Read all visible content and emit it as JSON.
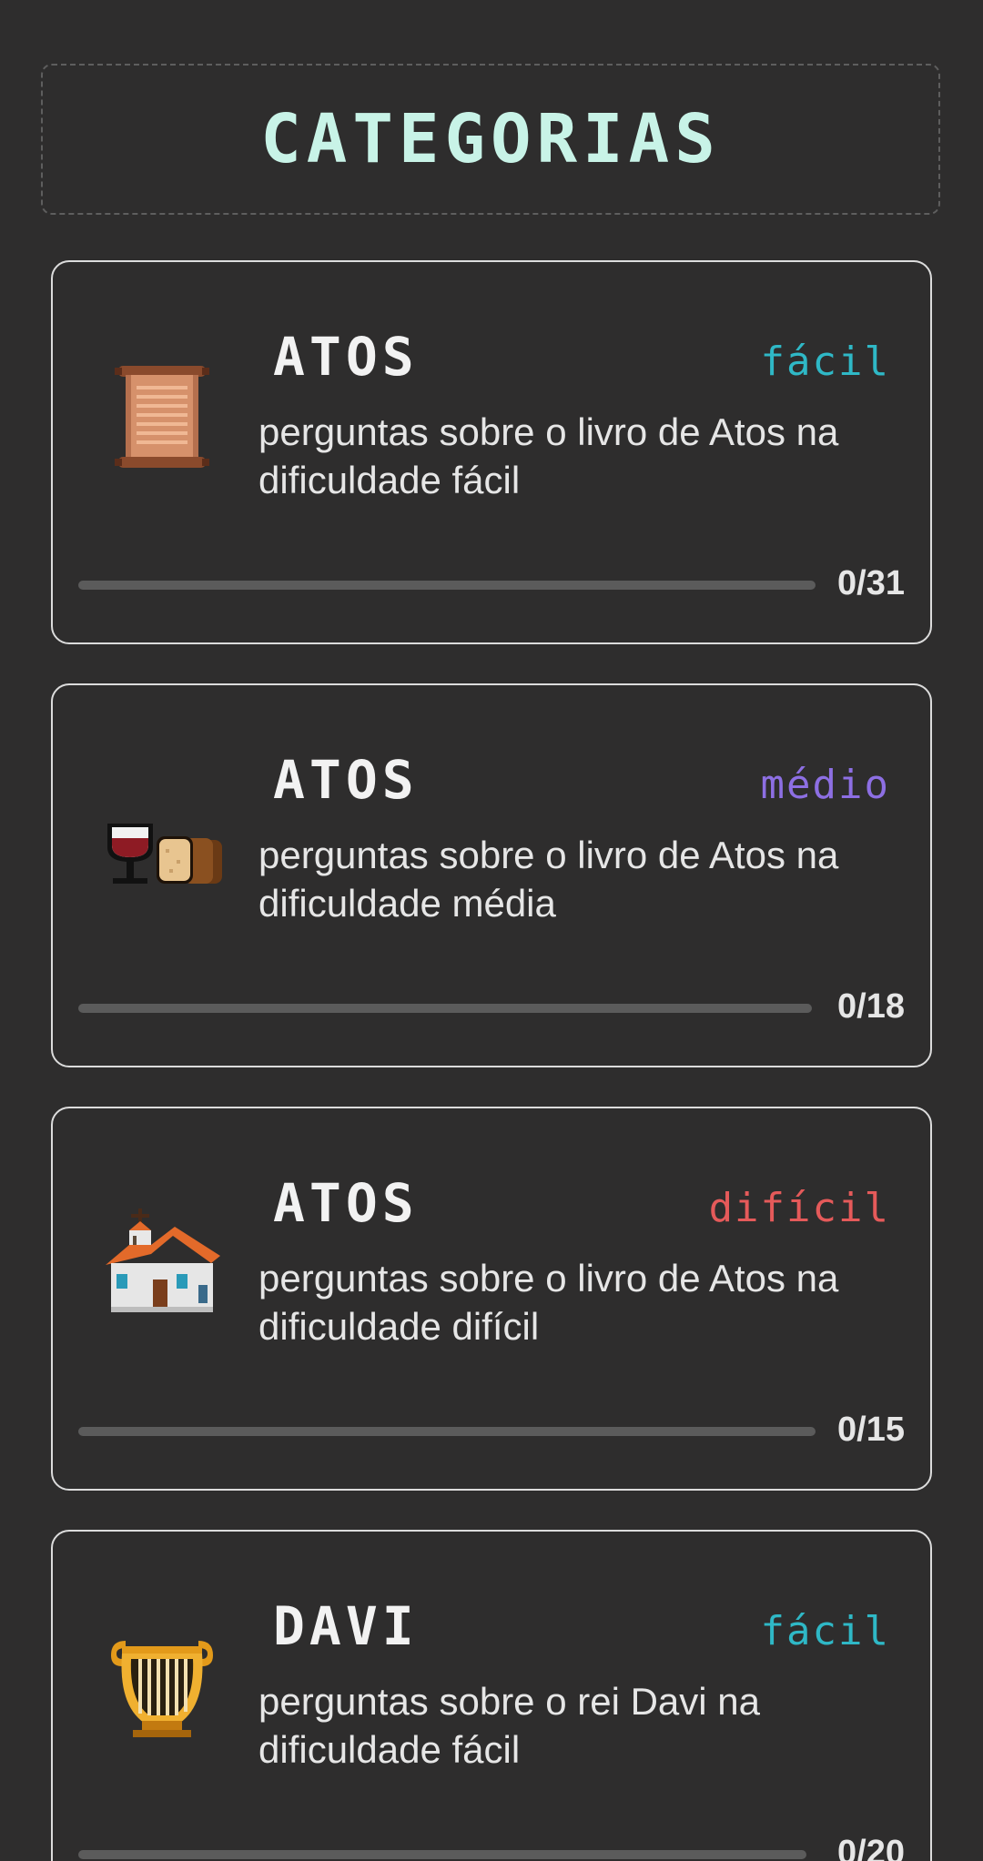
{
  "header": {
    "title": "CATEGORIAS"
  },
  "colors": {
    "background": "#2e2d2d",
    "title": "#c8f3e7",
    "facil": "#2fb8c6",
    "medio": "#8d6fe3",
    "dificil": "#e55a5a"
  },
  "categories": [
    {
      "title": "ATOS",
      "difficulty": "fácil",
      "difficulty_color": "#2fb8c6",
      "description": "perguntas sobre o livro de Atos na dificuldade fácil",
      "progress_label": "0/31",
      "progress_fraction": 0,
      "icon": "scroll-icon"
    },
    {
      "title": "ATOS",
      "difficulty": "médio",
      "difficulty_color": "#8d6fe3",
      "description": "perguntas sobre o livro de Atos na dificuldade média",
      "progress_label": "0/18",
      "progress_fraction": 0,
      "icon": "wine-bread-icon"
    },
    {
      "title": "ATOS",
      "difficulty": "difícil",
      "difficulty_color": "#e55a5a",
      "description": "perguntas sobre o livro de Atos na dificuldade difícil",
      "progress_label": "0/15",
      "progress_fraction": 0,
      "icon": "church-icon"
    },
    {
      "title": "DAVI",
      "difficulty": "fácil",
      "difficulty_color": "#2fb8c6",
      "description": "perguntas sobre o rei Davi na dificuldade fácil",
      "progress_label": "0/20",
      "progress_fraction": 0,
      "icon": "harp-icon"
    }
  ]
}
